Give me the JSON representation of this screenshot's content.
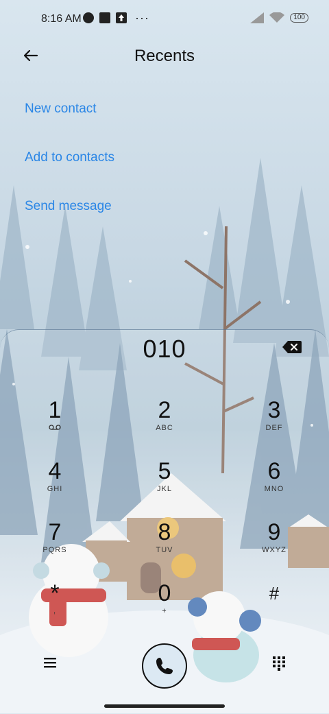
{
  "status_bar": {
    "time": "8:16 AM",
    "battery": "100",
    "more": "···"
  },
  "header": {
    "title": "Recents"
  },
  "actions": {
    "new_contact": "New contact",
    "add_to_contacts": "Add to contacts",
    "send_message": "Send message"
  },
  "dialer": {
    "number": "010",
    "keys": [
      {
        "digit": "1",
        "sub": "ᴏᴏ"
      },
      {
        "digit": "2",
        "sub": "ABC"
      },
      {
        "digit": "3",
        "sub": "DEF"
      },
      {
        "digit": "4",
        "sub": "GHI"
      },
      {
        "digit": "5",
        "sub": "JKL"
      },
      {
        "digit": "6",
        "sub": "MNO"
      },
      {
        "digit": "7",
        "sub": "PQRS"
      },
      {
        "digit": "8",
        "sub": "TUV"
      },
      {
        "digit": "9",
        "sub": "WXYZ"
      },
      {
        "digit": "*",
        "sub": ","
      },
      {
        "digit": "0",
        "sub": "+"
      },
      {
        "digit": "#",
        "sub": ""
      }
    ]
  },
  "colors": {
    "accent": "#2a86e6",
    "call_button_bg": "#dce9f3"
  },
  "icons": {
    "back": "arrow-left-icon",
    "backspace": "backspace-icon",
    "call": "phone-icon",
    "menu": "menu-icon",
    "keypad": "dialpad-icon"
  }
}
